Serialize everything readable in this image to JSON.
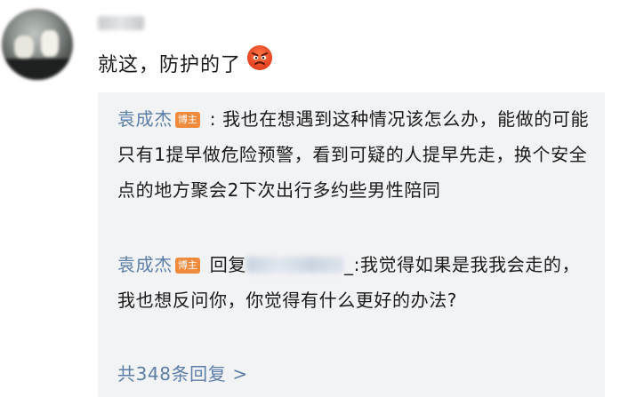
{
  "comment": {
    "text": "就这，防护的了",
    "emoji_icon": "angry-face-icon"
  },
  "replies": [
    {
      "author": "袁成杰",
      "badge": "博主",
      "separator": " : ",
      "text": "我也在想遇到这种情况该怎么办，能做的可能只有1提早做危险预警，看到可疑的人提早先走，换个安全点的地方聚会2下次出行多约些男性陪同"
    },
    {
      "author": "袁成杰",
      "badge": "博主",
      "reply_prefix": "回复",
      "suffix_before_text": "_:",
      "text": "我觉得如果是我我会走的，我也想反问你，你觉得有什么更好的办法?"
    }
  ],
  "more_replies_label": "共348条回复 >",
  "colors": {
    "author": "#5d7ea8",
    "badge": "#f08a3c",
    "reply_background": "#f2f3f5"
  }
}
